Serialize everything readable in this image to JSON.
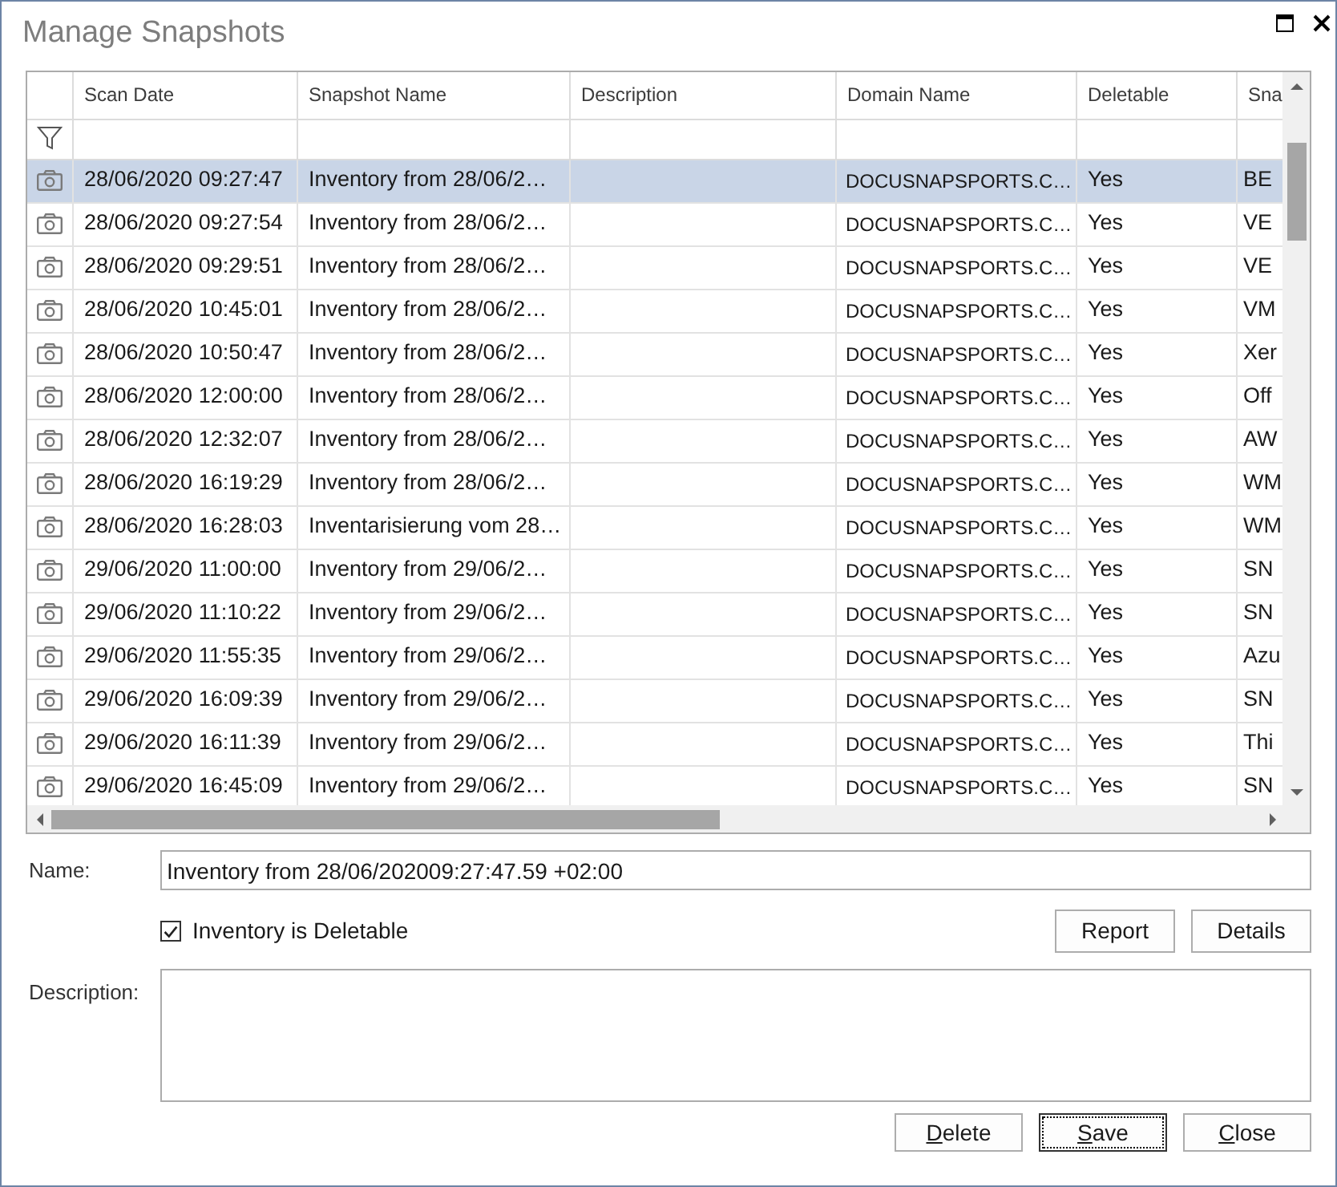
{
  "window": {
    "title": "Manage Snapshots"
  },
  "grid": {
    "columns": [
      "Scan Date",
      "Snapshot Name",
      "Description",
      "Domain Name",
      "Deletable",
      "Sna"
    ],
    "rows": [
      {
        "selected": true,
        "scan_date": "28/06/2020 09:27:47",
        "snapshot_name": "Inventory from 28/06/2…",
        "domain_name": "DOCUSNAPSPORTS.C…",
        "deletable": "Yes",
        "column_6": "BE"
      },
      {
        "selected": false,
        "scan_date": "28/06/2020 09:27:54",
        "snapshot_name": "Inventory from 28/06/2…",
        "domain_name": "DOCUSNAPSPORTS.C…",
        "deletable": "Yes",
        "column_6": "VE"
      },
      {
        "selected": false,
        "scan_date": "28/06/2020 09:29:51",
        "snapshot_name": "Inventory from 28/06/2…",
        "domain_name": "DOCUSNAPSPORTS.C…",
        "deletable": "Yes",
        "column_6": "VE"
      },
      {
        "selected": false,
        "scan_date": "28/06/2020 10:45:01",
        "snapshot_name": "Inventory from 28/06/2…",
        "domain_name": "DOCUSNAPSPORTS.C…",
        "deletable": "Yes",
        "column_6": "VM"
      },
      {
        "selected": false,
        "scan_date": "28/06/2020 10:50:47",
        "snapshot_name": "Inventory from 28/06/2…",
        "domain_name": "DOCUSNAPSPORTS.C…",
        "deletable": "Yes",
        "column_6": "Xer"
      },
      {
        "selected": false,
        "scan_date": "28/06/2020 12:00:00",
        "snapshot_name": "Inventory from 28/06/2…",
        "domain_name": "DOCUSNAPSPORTS.C…",
        "deletable": "Yes",
        "column_6": "Off"
      },
      {
        "selected": false,
        "scan_date": "28/06/2020 12:32:07",
        "snapshot_name": "Inventory from 28/06/2…",
        "domain_name": "DOCUSNAPSPORTS.C…",
        "deletable": "Yes",
        "column_6": "AW"
      },
      {
        "selected": false,
        "scan_date": "28/06/2020 16:19:29",
        "snapshot_name": "Inventory from 28/06/2…",
        "domain_name": "DOCUSNAPSPORTS.C…",
        "deletable": "Yes",
        "column_6": "WM"
      },
      {
        "selected": false,
        "scan_date": "28/06/2020 16:28:03",
        "snapshot_name": "Inventarisierung vom 28…",
        "domain_name": "DOCUSNAPSPORTS.C…",
        "deletable": "Yes",
        "column_6": "WM"
      },
      {
        "selected": false,
        "scan_date": "29/06/2020 11:00:00",
        "snapshot_name": "Inventory from 29/06/2…",
        "domain_name": "DOCUSNAPSPORTS.C…",
        "deletable": "Yes",
        "column_6": "SN"
      },
      {
        "selected": false,
        "scan_date": "29/06/2020 11:10:22",
        "snapshot_name": "Inventory from 29/06/2…",
        "domain_name": "DOCUSNAPSPORTS.C…",
        "deletable": "Yes",
        "column_6": "SN"
      },
      {
        "selected": false,
        "scan_date": "29/06/2020 11:55:35",
        "snapshot_name": "Inventory from 29/06/2…",
        "domain_name": "DOCUSNAPSPORTS.C…",
        "deletable": "Yes",
        "column_6": "Azu"
      },
      {
        "selected": false,
        "scan_date": "29/06/2020 16:09:39",
        "snapshot_name": "Inventory from 29/06/2…",
        "domain_name": "DOCUSNAPSPORTS.C…",
        "deletable": "Yes",
        "column_6": "SN"
      },
      {
        "selected": false,
        "scan_date": "29/06/2020 16:11:39",
        "snapshot_name": "Inventory from 29/06/2…",
        "domain_name": "DOCUSNAPSPORTS.C…",
        "deletable": "Yes",
        "column_6": "Thi"
      },
      {
        "selected": false,
        "scan_date": "29/06/2020 16:45:09",
        "snapshot_name": "Inventory from 29/06/2…",
        "domain_name": "DOCUSNAPSPORTS.C…",
        "deletable": "Yes",
        "column_6": "SN"
      }
    ]
  },
  "form": {
    "name": {
      "label": "Name:",
      "value": "Inventory from 28/06/202009:27:47.59 +02:00"
    },
    "deletable": {
      "label": "Inventory is Deletable",
      "checked": true
    },
    "side_buttons": [
      {
        "label": "Report"
      },
      {
        "label": "Details"
      }
    ],
    "description": {
      "label": "Description:"
    },
    "buttons": [
      {
        "label": "Delete",
        "access_key": true,
        "focused": false
      },
      {
        "label": "Save",
        "access_key": true,
        "focused": true
      },
      {
        "label": "Close",
        "access_key": true,
        "focused": false
      }
    ]
  }
}
